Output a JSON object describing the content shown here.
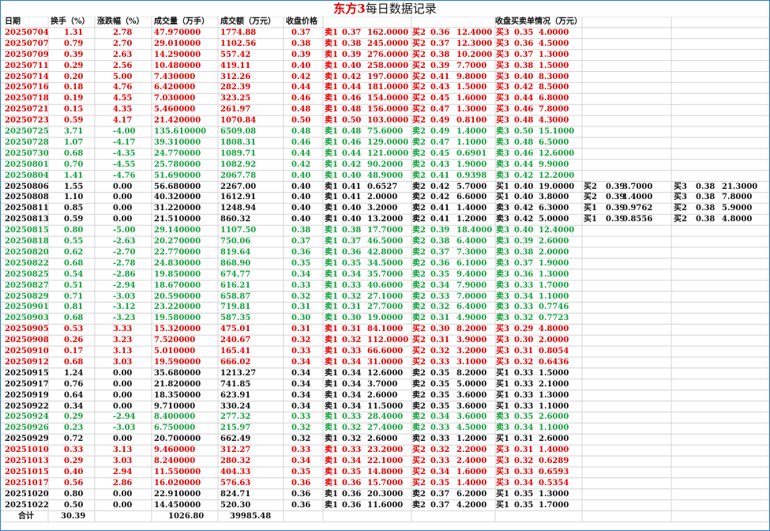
{
  "title": {
    "accent": "东方3",
    "rest": "每日数据记录"
  },
  "colors": {
    "up": "#e00000",
    "down": "#14a03c",
    "flat": "#111111"
  },
  "headers": {
    "date": "日期",
    "turnover": "换手（%）",
    "change": "涨跌幅（%）",
    "volume": "成交量（万手）",
    "amount": "成交额（万元）",
    "close": "收盘价格",
    "orders": "收盘买卖单情况（万元）"
  },
  "rows": [
    {
      "c": "r",
      "v": [
        "20250704",
        "1.31",
        "2.78",
        "47.970000",
        "1774.88",
        "0.37",
        "卖1",
        "0.37",
        "162.0000",
        "买2",
        "0.36",
        "12.4000",
        "买3",
        "0.35",
        "4.0000",
        "",
        "",
        "",
        "",
        "",
        "",
        ""
      ]
    },
    {
      "c": "r",
      "v": [
        "20250707",
        "0.79",
        "2.70",
        "29.010000",
        "1102.56",
        "0.38",
        "卖1",
        "0.38",
        "245.0000",
        "买2",
        "0.37",
        "12.3000",
        "买3",
        "0.36",
        "4.5000",
        "",
        "",
        "",
        "",
        "",
        "",
        ""
      ]
    },
    {
      "c": "r",
      "v": [
        "20250709",
        "0.39",
        "2.63",
        "14.290000",
        "557.42",
        "0.39",
        "卖1",
        "0.39",
        "276.0000",
        "买2",
        "0.38",
        "10.2000",
        "买3",
        "0.37",
        "1.3000",
        "",
        "",
        "",
        "",
        "",
        "",
        ""
      ]
    },
    {
      "c": "r",
      "v": [
        "20250711",
        "0.29",
        "2.56",
        "10.480000",
        "419.11",
        "0.40",
        "卖1",
        "0.40",
        "258.0000",
        "买2",
        "0.39",
        "7.7000",
        "买3",
        "0.38",
        "1.5000",
        "",
        "",
        "",
        "",
        "",
        "",
        ""
      ]
    },
    {
      "c": "r",
      "v": [
        "20250714",
        "0.20",
        "5.00",
        "7.430000",
        "312.26",
        "0.42",
        "卖1",
        "0.42",
        "197.0000",
        "买2",
        "0.41",
        "9.8000",
        "买3",
        "0.40",
        "8.3000",
        "",
        "",
        "",
        "",
        "",
        "",
        ""
      ]
    },
    {
      "c": "r",
      "v": [
        "20250716",
        "0.18",
        "4.76",
        "6.420000",
        "282.39",
        "0.44",
        "卖1",
        "0.44",
        "181.0000",
        "买2",
        "0.43",
        "1.5000",
        "买3",
        "0.42",
        "8.5000",
        "",
        "",
        "",
        "",
        "",
        "",
        ""
      ]
    },
    {
      "c": "r",
      "v": [
        "20250718",
        "0.19",
        "4.55",
        "7.030000",
        "323.25",
        "0.46",
        "卖1",
        "0.46",
        "154.0000",
        "买2",
        "0.45",
        "1.6000",
        "买3",
        "0.44",
        "6.8000",
        "",
        "",
        "",
        "",
        "",
        "",
        ""
      ]
    },
    {
      "c": "r",
      "v": [
        "20250721",
        "0.15",
        "4.35",
        "5.460000",
        "261.97",
        "0.48",
        "卖1",
        "0.48",
        "156.0000",
        "买2",
        "0.47",
        "1.3000",
        "买3",
        "0.46",
        "7.8000",
        "",
        "",
        "",
        "",
        "",
        "",
        ""
      ]
    },
    {
      "c": "r",
      "v": [
        "20250723",
        "0.59",
        "4.17",
        "21.420000",
        "1070.84",
        "0.50",
        "卖1",
        "0.50",
        "103.0000",
        "买2",
        "0.49",
        "0.8100",
        "买3",
        "0.48",
        "4.3000",
        "",
        "",
        "",
        "",
        "",
        "",
        ""
      ]
    },
    {
      "c": "g",
      "v": [
        "20250725",
        "3.71",
        "-4.00",
        "135.610000",
        "6509.08",
        "0.48",
        "卖1",
        "0.48",
        "75.6000",
        "卖2",
        "0.49",
        "1.4000",
        "卖3",
        "0.50",
        "15.1000",
        "",
        "",
        "",
        "",
        "",
        "",
        ""
      ]
    },
    {
      "c": "g",
      "v": [
        "20250728",
        "1.07",
        "-4.17",
        "39.310000",
        "1808.31",
        "0.46",
        "卖1",
        "0.46",
        "129.0000",
        "卖2",
        "0.47",
        "1.1000",
        "卖3",
        "0.48",
        "6.5000",
        "",
        "",
        "",
        "",
        "",
        "",
        ""
      ]
    },
    {
      "c": "g",
      "v": [
        "20250730",
        "0.68",
        "-4.35",
        "24.770000",
        "1089.71",
        "0.44",
        "卖1",
        "0.44",
        "121.0000",
        "卖2",
        "0.45",
        "0.6901",
        "卖3",
        "0.46",
        "12.6000",
        "",
        "",
        "",
        "",
        "",
        "",
        ""
      ]
    },
    {
      "c": "g",
      "v": [
        "20250801",
        "0.70",
        "-4.55",
        "25.780000",
        "1082.92",
        "0.42",
        "卖1",
        "0.42",
        "90.2000",
        "卖2",
        "0.43",
        "1.9000",
        "卖3",
        "0.44",
        "9.9000",
        "",
        "",
        "",
        "",
        "",
        "",
        ""
      ]
    },
    {
      "c": "g",
      "v": [
        "20250804",
        "1.41",
        "-4.76",
        "51.690000",
        "2067.78",
        "0.40",
        "卖1",
        "0.40",
        "48.9000",
        "卖2",
        "0.41",
        "0.9398",
        "卖3",
        "0.42",
        "12.2000",
        "",
        "",
        "",
        "",
        "",
        "",
        ""
      ]
    },
    {
      "c": "k",
      "v": [
        "20250806",
        "1.55",
        "0.00",
        "56.680000",
        "2267.00",
        "0.40",
        "卖1",
        "0.41",
        "0.6527",
        "卖2",
        "0.42",
        "5.7000",
        "买1",
        "0.40",
        "19.0000",
        "买2",
        "0.39",
        "3.7000",
        "买3",
        "0.38",
        "21.3000",
        ""
      ]
    },
    {
      "c": "k",
      "v": [
        "20250808",
        "1.10",
        "0.00",
        "40.320000",
        "1612.91",
        "0.40",
        "卖1",
        "0.41",
        "2.0000",
        "卖2",
        "0.42",
        "6.6000",
        "买1",
        "0.40",
        "3.8000",
        "买2",
        "0.39",
        "1.4000",
        "买3",
        "0.38",
        "7.8000",
        ""
      ]
    },
    {
      "c": "k",
      "v": [
        "20250811",
        "0.85",
        "0.00",
        "31.220000",
        "1248.94",
        "0.40",
        "卖1",
        "0.40",
        "3.2000",
        "卖2",
        "0.41",
        "1.4000",
        "卖3",
        "0.42",
        "6.3000",
        "买1",
        "0.39",
        "0.9762",
        "买2",
        "0.38",
        "5.9000",
        ""
      ]
    },
    {
      "c": "k",
      "v": [
        "20250813",
        "0.59",
        "0.00",
        "21.510000",
        "860.32",
        "0.40",
        "卖1",
        "0.40",
        "13.2000",
        "卖2",
        "0.41",
        "1.2000",
        "卖3",
        "0.42",
        "5.0000",
        "买1",
        "0.39",
        "0.8556",
        "买2",
        "0.38",
        "4.8000",
        ""
      ]
    },
    {
      "c": "g",
      "v": [
        "20250815",
        "0.80",
        "-5.00",
        "29.140000",
        "1107.50",
        "0.38",
        "卖1",
        "0.38",
        "17.7000",
        "卖2",
        "0.39",
        "18.4000",
        "卖3",
        "0.40",
        "12.4000",
        "",
        "",
        "",
        "",
        "",
        "",
        ""
      ]
    },
    {
      "c": "g",
      "v": [
        "20250818",
        "0.55",
        "-2.63",
        "20.270000",
        "750.06",
        "0.37",
        "卖1",
        "0.37",
        "46.5000",
        "卖2",
        "0.38",
        "6.4000",
        "卖3",
        "0.39",
        "2.6000",
        "",
        "",
        "",
        "",
        "",
        "",
        ""
      ]
    },
    {
      "c": "g",
      "v": [
        "20250820",
        "0.62",
        "-2.70",
        "22.770000",
        "819.64",
        "0.36",
        "卖1",
        "0.36",
        "42.8000",
        "卖2",
        "0.37",
        "7.3000",
        "卖3",
        "0.38",
        "2.0000",
        "",
        "",
        "",
        "",
        "",
        "",
        ""
      ]
    },
    {
      "c": "g",
      "v": [
        "20250822",
        "0.68",
        "-2.78",
        "24.830000",
        "868.90",
        "0.35",
        "卖1",
        "0.35",
        "34.5000",
        "卖2",
        "0.36",
        "6.1000",
        "卖3",
        "0.37",
        "1.9000",
        "",
        "",
        "",
        "",
        "",
        "",
        ""
      ]
    },
    {
      "c": "g",
      "v": [
        "20250825",
        "0.54",
        "-2.86",
        "19.850000",
        "674.77",
        "0.34",
        "卖1",
        "0.34",
        "35.7000",
        "卖2",
        "0.35",
        "9.4000",
        "卖3",
        "0.36",
        "1.3000",
        "",
        "",
        "",
        "",
        "",
        "",
        ""
      ]
    },
    {
      "c": "g",
      "v": [
        "20250827",
        "0.51",
        "-2.94",
        "18.670000",
        "616.21",
        "0.33",
        "卖1",
        "0.33",
        "40.6000",
        "卖2",
        "0.34",
        "7.9000",
        "卖3",
        "0.33",
        "1.7000",
        "",
        "",
        "",
        "",
        "",
        "",
        ""
      ]
    },
    {
      "c": "g",
      "v": [
        "20250829",
        "0.71",
        "-3.03",
        "20.590000",
        "658.87",
        "0.32",
        "卖1",
        "0.32",
        "27.1000",
        "卖2",
        "0.33",
        "7.0000",
        "卖3",
        "0.34",
        "1.1000",
        "",
        "",
        "",
        "",
        "",
        "",
        ""
      ]
    },
    {
      "c": "g",
      "v": [
        "20250901",
        "0.81",
        "-3.12",
        "23.220000",
        "719.81",
        "0.31",
        "卖1",
        "0.31",
        "27.7000",
        "卖2",
        "0.32",
        "6.4000",
        "卖3",
        "0.33",
        "0.7746",
        "",
        "",
        "",
        "",
        "",
        "",
        ""
      ]
    },
    {
      "c": "g",
      "v": [
        "20250903",
        "0.68",
        "-3.23",
        "19.580000",
        "587.35",
        "0.30",
        "卖1",
        "0.30",
        "19.0000",
        "卖2",
        "0.31",
        "4.9000",
        "卖3",
        "0.32",
        "0.7723",
        "",
        "",
        "",
        "",
        "",
        "",
        ""
      ]
    },
    {
      "c": "r",
      "v": [
        "20250905",
        "0.53",
        "3.33",
        "15.320000",
        "475.01",
        "0.31",
        "卖1",
        "0.31",
        "84.1000",
        "买2",
        "0.30",
        "8.2000",
        "买3",
        "0.29",
        "4.8000",
        "",
        "",
        "",
        "",
        "",
        "",
        ""
      ]
    },
    {
      "c": "r",
      "v": [
        "20250908",
        "0.26",
        "3.23",
        "7.520000",
        "240.67",
        "0.32",
        "卖1",
        "0.32",
        "112.0000",
        "买2",
        "0.31",
        "3.9000",
        "买3",
        "0.30",
        "2.0000",
        "",
        "",
        "",
        "",
        "",
        "",
        ""
      ]
    },
    {
      "c": "r",
      "v": [
        "20250910",
        "0.17",
        "3.13",
        "5.010000",
        "165.41",
        "0.33",
        "卖1",
        "0.33",
        "66.6000",
        "买2",
        "0.32",
        "3.2000",
        "买3",
        "0.31",
        "0.8054",
        "",
        "",
        "",
        "",
        "",
        "",
        ""
      ]
    },
    {
      "c": "r",
      "v": [
        "20250912",
        "0.68",
        "3.03",
        "19.590000",
        "666.02",
        "0.34",
        "卖1",
        "0.34",
        "31.0000",
        "买2",
        "0.33",
        "3.1000",
        "买3",
        "0.32",
        "0.6436",
        "",
        "",
        "",
        "",
        "",
        "",
        ""
      ]
    },
    {
      "c": "k",
      "v": [
        "20250915",
        "1.24",
        "0.00",
        "35.680000",
        "1213.27",
        "0.34",
        "卖1",
        "0.34",
        "12.6000",
        "卖2",
        "0.35",
        "8.2000",
        "买1",
        "0.33",
        "1.5000",
        "",
        "",
        "",
        "",
        "",
        "",
        ""
      ]
    },
    {
      "c": "k",
      "v": [
        "20250917",
        "0.76",
        "0.00",
        "21.820000",
        "741.85",
        "0.34",
        "卖1",
        "0.34",
        "3.7000",
        "卖2",
        "0.35",
        "5.0000",
        "买1",
        "0.33",
        "2.1000",
        "",
        "",
        "",
        "",
        "",
        "",
        ""
      ]
    },
    {
      "c": "k",
      "v": [
        "20250919",
        "0.64",
        "0.00",
        "18.350000",
        "623.91",
        "0.34",
        "卖1",
        "0.34",
        "2.6000",
        "卖2",
        "0.35",
        "3.6000",
        "买1",
        "0.33",
        "1.3000",
        "",
        "",
        "",
        "",
        "",
        "",
        ""
      ]
    },
    {
      "c": "k",
      "v": [
        "20250922",
        "0.34",
        "0.00",
        "9.710000",
        "330.24",
        "0.34",
        "卖1",
        "0.34",
        "11.5000",
        "卖2",
        "0.35",
        "3.6000",
        "买1",
        "0.33",
        "1.1000",
        "",
        "",
        "",
        "",
        "",
        "",
        ""
      ]
    },
    {
      "c": "g",
      "v": [
        "20250924",
        "0.29",
        "-2.94",
        "8.400000",
        "277.32",
        "0.33",
        "卖1",
        "0.33",
        "28.4000",
        "卖2",
        "0.34",
        "3.6000",
        "卖3",
        "0.35",
        "2.6000",
        "",
        "",
        "",
        "",
        "",
        "",
        ""
      ]
    },
    {
      "c": "g",
      "v": [
        "20250926",
        "0.23",
        "-3.03",
        "6.750000",
        "215.97",
        "0.32",
        "卖1",
        "0.32",
        "27.4000",
        "卖2",
        "0.33",
        "4.5000",
        "卖3",
        "0.34",
        "1.1000",
        "",
        "",
        "",
        "",
        "",
        "",
        ""
      ]
    },
    {
      "c": "k",
      "v": [
        "20250929",
        "0.72",
        "0.00",
        "20.700000",
        "662.49",
        "0.32",
        "卖1",
        "0.32",
        "2.6000",
        "卖2",
        "0.33",
        "1.2000",
        "买1",
        "0.31",
        "2.6000",
        "",
        "",
        "",
        "",
        "",
        "",
        ""
      ]
    },
    {
      "c": "r",
      "v": [
        "20251010",
        "0.33",
        "3.13",
        "9.460000",
        "312.27",
        "0.33",
        "卖1",
        "0.33",
        "23.2000",
        "买2",
        "0.32",
        "2.2000",
        "买3",
        "0.31",
        "1.4000",
        "",
        "",
        "",
        "",
        "",
        "",
        ""
      ]
    },
    {
      "c": "r",
      "v": [
        "20251013",
        "0.29",
        "3.03",
        "8.240000",
        "280.32",
        "0.34",
        "卖1",
        "0.34",
        "22.1000",
        "买2",
        "0.33",
        "2.4000",
        "买3",
        "0.32",
        "0.6289",
        "",
        "",
        "",
        "",
        "",
        "",
        ""
      ]
    },
    {
      "c": "r",
      "v": [
        "20251015",
        "0.40",
        "2.94",
        "11.550000",
        "404.33",
        "0.35",
        "卖1",
        "0.35",
        "14.8000",
        "买2",
        "0.34",
        "1.6000",
        "买3",
        "0.33",
        "0.6593",
        "",
        "",
        "",
        "",
        "",
        "",
        ""
      ]
    },
    {
      "c": "r",
      "v": [
        "20251017",
        "0.56",
        "2.86",
        "16.020000",
        "576.63",
        "0.36",
        "卖1",
        "0.36",
        "15.7000",
        "买2",
        "0.35",
        "1.4000",
        "买3",
        "0.34",
        "0.5354",
        "",
        "",
        "",
        "",
        "",
        "",
        ""
      ]
    },
    {
      "c": "k",
      "v": [
        "20251020",
        "0.80",
        "0.00",
        "22.910000",
        "824.71",
        "0.36",
        "卖1",
        "0.36",
        "20.3000",
        "卖2",
        "0.37",
        "6.2000",
        "买1",
        "0.35",
        "1.3000",
        "",
        "",
        "",
        "",
        "",
        "",
        ""
      ]
    },
    {
      "c": "k",
      "v": [
        "20251022",
        "0.50",
        "0.00",
        "14.450000",
        "520.30",
        "0.36",
        "卖1",
        "0.36",
        "11.6000",
        "卖2",
        "0.37",
        "4.2000",
        "买1",
        "0.35",
        "1.7000",
        "",
        "",
        "",
        "",
        "",
        "",
        ""
      ]
    }
  ],
  "totals": {
    "label": "合计",
    "turnover": "30.39",
    "volume": "1026.80",
    "amount": "39985.48"
  }
}
